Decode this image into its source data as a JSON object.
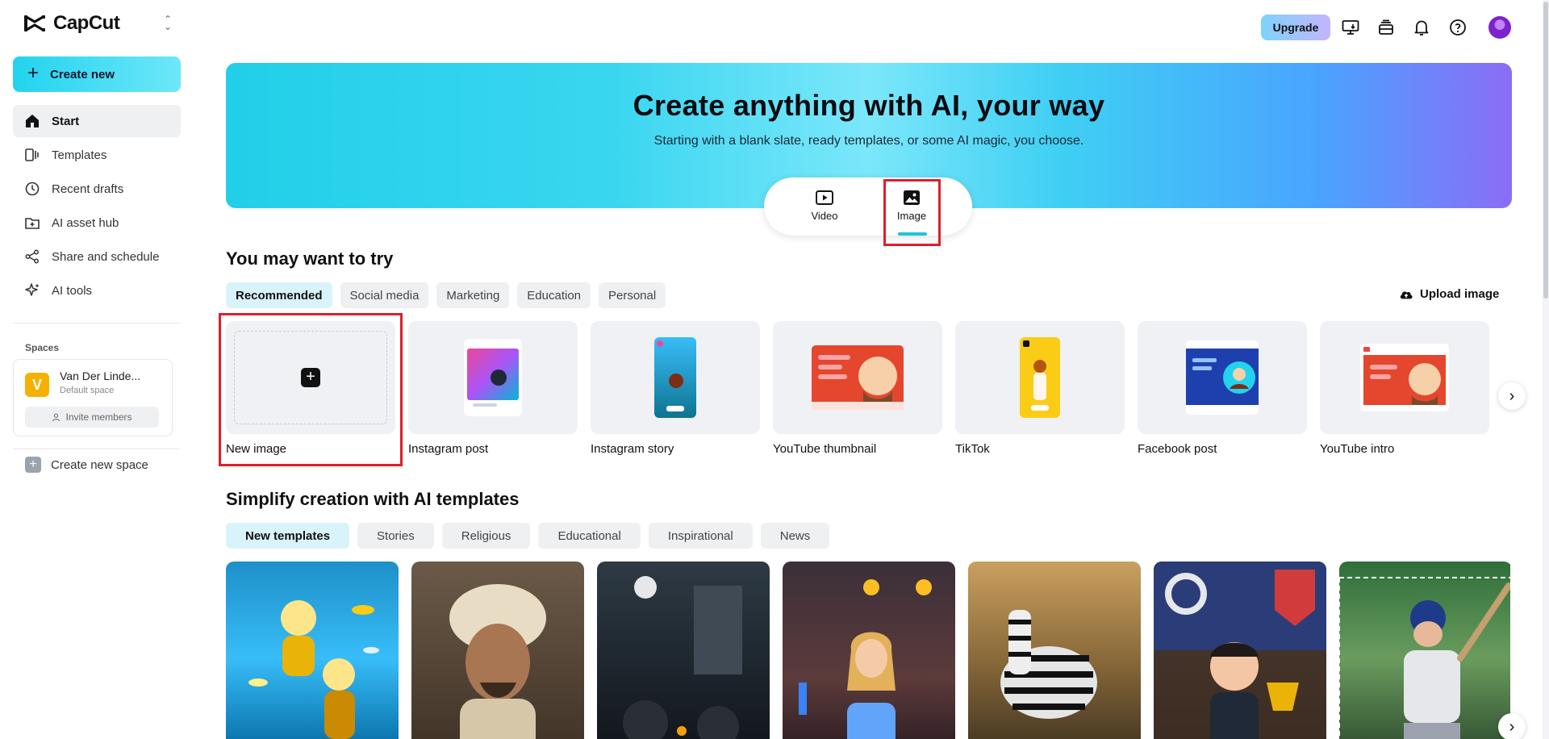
{
  "app": {
    "name": "CapCut"
  },
  "sidebar": {
    "create_label": "Create new",
    "items": [
      {
        "label": "Start",
        "icon": "home-icon"
      },
      {
        "label": "Templates",
        "icon": "templates-icon"
      },
      {
        "label": "Recent drafts",
        "icon": "clock-icon"
      },
      {
        "label": "AI asset hub",
        "icon": "asset-hub-icon"
      },
      {
        "label": "Share and schedule",
        "icon": "share-icon"
      },
      {
        "label": "AI tools",
        "icon": "sparkle-icon"
      }
    ],
    "spaces_label": "Spaces",
    "space": {
      "initial": "V",
      "name": "Van Der Linde...",
      "subtitle": "Default space",
      "invite_label": "Invite members"
    },
    "new_space_label": "Create new space"
  },
  "topbar": {
    "upgrade_label": "Upgrade"
  },
  "hero": {
    "title": "Create anything with AI, your way",
    "subtitle": "Starting with a blank slate, ready templates, or some AI magic, you choose.",
    "modes": [
      {
        "label": "Video",
        "icon": "video-play-icon"
      },
      {
        "label": "Image",
        "icon": "image-icon",
        "selected": true
      }
    ]
  },
  "try_section": {
    "title": "You may want to try",
    "chips": [
      "Recommended",
      "Social media",
      "Marketing",
      "Education",
      "Personal"
    ],
    "active_chip": "Recommended",
    "upload_label": "Upload image",
    "cards": [
      "New image",
      "Instagram post",
      "Instagram story",
      "YouTube thumbnail",
      "TikTok",
      "Facebook post",
      "YouTube intro"
    ]
  },
  "ai_templates": {
    "title": "Simplify creation with AI templates",
    "chips": [
      "New templates",
      "Stories",
      "Religious",
      "Educational",
      "Inspirational",
      "News"
    ],
    "active_chip": "New templates"
  },
  "colors": {
    "accent": "#22d3ee",
    "highlight_box": "#e11d2a"
  }
}
